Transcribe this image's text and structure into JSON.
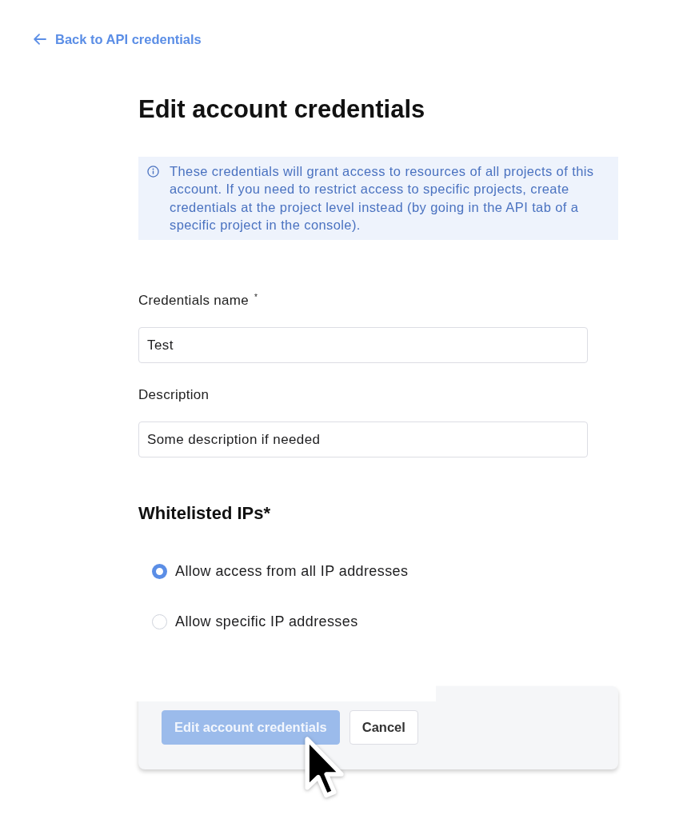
{
  "back_link": {
    "label": "Back to API credentials"
  },
  "title": "Edit account credentials",
  "notice": {
    "text": "These credentials will grant access to resources of all projects of this account. If you need to restrict access to specific projects, create credentials at the project level instead (by going in the API tab of a specific project in the console)."
  },
  "fields": [
    {
      "label": "Credentials name $^{*}$",
      "value": "Test"
    },
    {
      "label": "Description",
      "value": "Some description if needed"
    }
  ],
  "whitelist": {
    "heading": "Whitelisted IPs*",
    "options": [
      {
        "label": "Allow access from all IP addresses",
        "selected": true
      },
      {
        "label": "Allow specific IP addresses",
        "selected": false
      }
    ]
  },
  "footer": {
    "buttons": [
      {
        "label": "Edit account credentials",
        "kind": "primary",
        "disabled": true
      },
      {
        "label": "Cancel",
        "kind": "secondary",
        "disabled": false
      }
    ]
  }
}
